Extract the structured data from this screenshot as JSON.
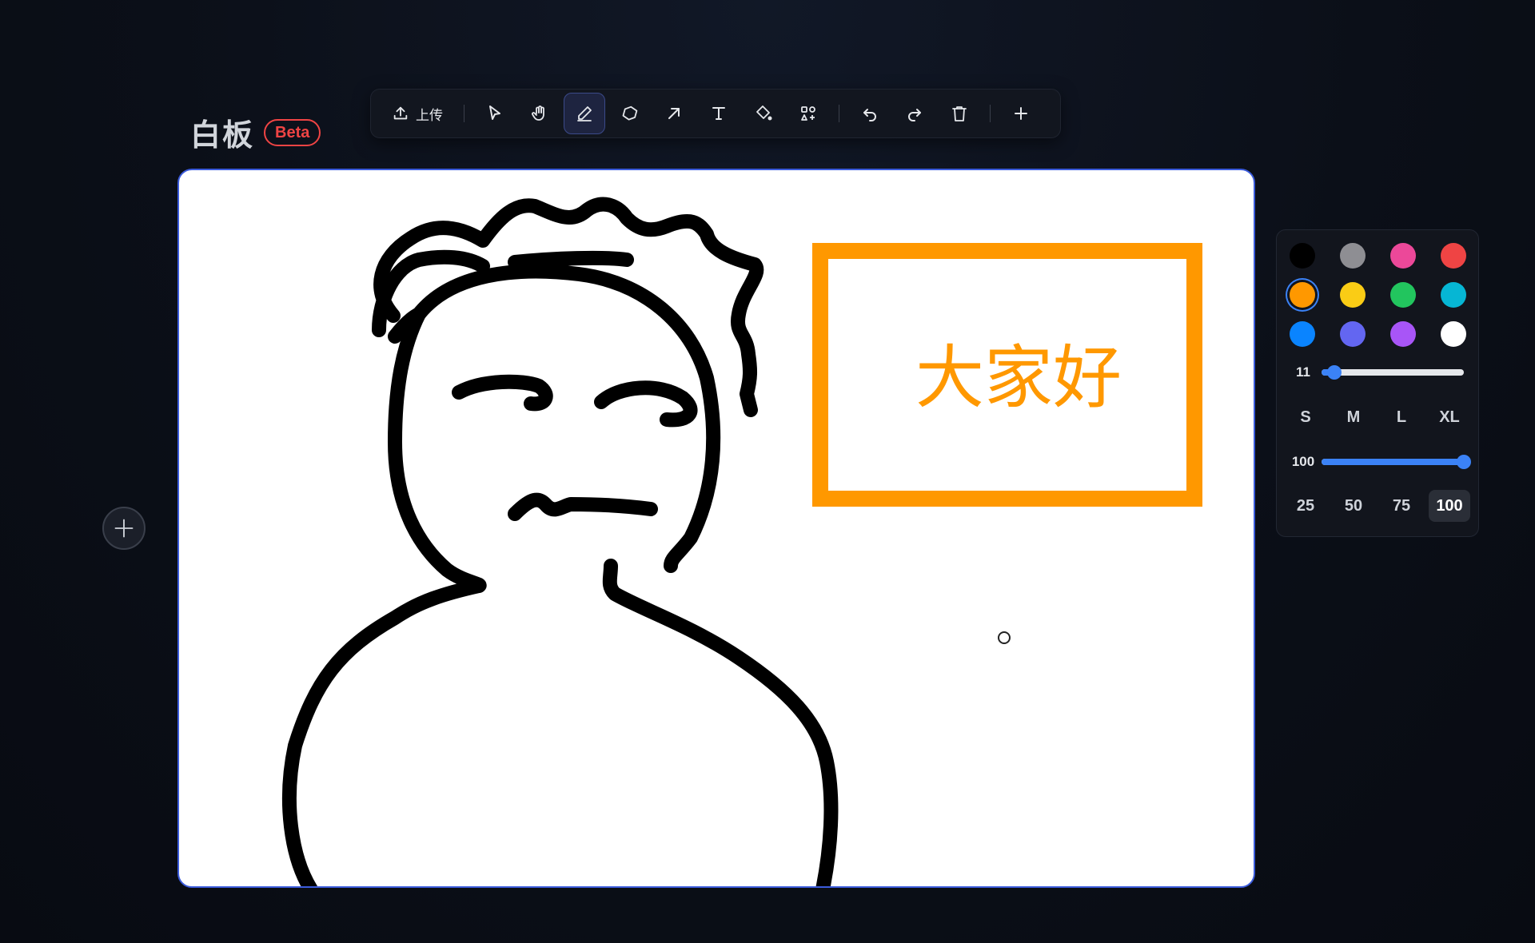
{
  "header": {
    "title": "白板",
    "badge": "Beta"
  },
  "toolbar": {
    "upload_label": "上传",
    "active_tool": "pen",
    "tools": [
      {
        "id": "select",
        "icon": "cursor-icon"
      },
      {
        "id": "hand",
        "icon": "hand-icon"
      },
      {
        "id": "pen",
        "icon": "pen-icon"
      },
      {
        "id": "eraser",
        "icon": "eraser-icon"
      },
      {
        "id": "arrow",
        "icon": "arrow-icon"
      },
      {
        "id": "text",
        "icon": "text-icon"
      },
      {
        "id": "fill",
        "icon": "paint-bucket-icon"
      },
      {
        "id": "shapes",
        "icon": "shapes-icon"
      },
      {
        "id": "undo",
        "icon": "undo-icon"
      },
      {
        "id": "redo",
        "icon": "redo-icon"
      },
      {
        "id": "delete",
        "icon": "trash-icon"
      },
      {
        "id": "add",
        "icon": "plus-icon"
      }
    ]
  },
  "canvas": {
    "text": "大家好",
    "text_color": "#ff9800",
    "box_color": "#ff9800",
    "stroke_color": "#000000"
  },
  "panel": {
    "selected_color": "#ff9800",
    "colors": [
      "#000000",
      "#8e8e93",
      "#ec4899",
      "#ef4444",
      "#ff9800",
      "#facc15",
      "#22c55e",
      "#06b6d4",
      "#0a84ff",
      "#6366f1",
      "#a855f7",
      "#ffffff"
    ],
    "size_value": "11",
    "size_fraction": 0.09,
    "size_options": [
      "S",
      "M",
      "L",
      "XL"
    ],
    "opacity_value": "100",
    "opacity_fraction": 1.0,
    "opacity_options": [
      "25",
      "50",
      "75",
      "100"
    ],
    "opacity_active": "100"
  },
  "accent": "#3b82f6"
}
